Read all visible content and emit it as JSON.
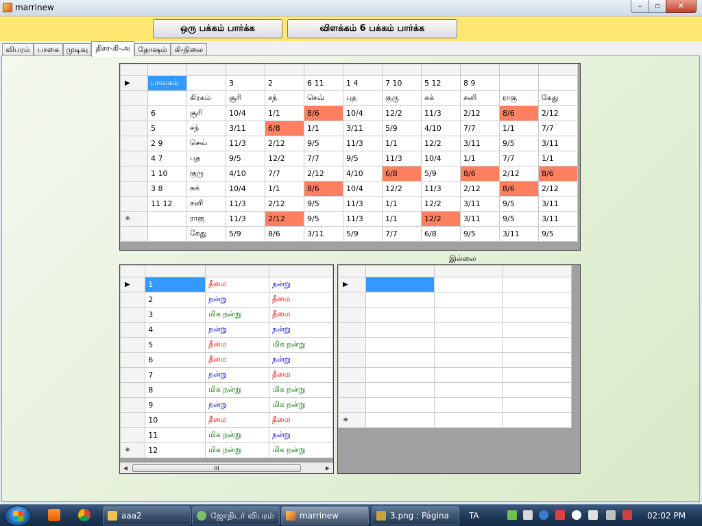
{
  "window": {
    "title": "marrinew",
    "min": "–",
    "max": "▫",
    "close": "✕"
  },
  "toolbar": {
    "btn_page": "ஒரு பக்கம் பார்க்க",
    "btn_detail": "விளக்கம் 6 பக்கம் பார்க்க"
  },
  "tabs": [
    "விபரம்",
    "பாகை",
    "முடிவு",
    "திசா-கி-அ",
    "தோஷம்",
    "கி-நிலை"
  ],
  "active_tab": 3,
  "grid1": {
    "header": [
      "",
      "",
      "",
      "",
      "",
      "",
      "",
      "",
      "",
      "",
      ""
    ],
    "row_markers": [
      "▶",
      "",
      "",
      "",
      "",
      "",
      "",
      "",
      "",
      "✳"
    ],
    "rows": [
      [
        "பாவகம்",
        "",
        "3",
        "2",
        "6 11",
        "1 4",
        "7 10",
        "5 12",
        "8 9",
        "",
        ""
      ],
      [
        "",
        "கிரகம்",
        "சூரி",
        "சந்",
        "செவ்",
        "புத",
        "குரு",
        "சுக்",
        "சனி",
        "ராகு",
        "கேது"
      ],
      [
        "6",
        "சூரி",
        "10/4",
        "1/1",
        "8/6",
        "10/4",
        "12/2",
        "11/3",
        "2/12",
        "8/6",
        "2/12"
      ],
      [
        "5",
        "சந்",
        "3/11",
        "6/8",
        "1/1",
        "3/11",
        "5/9",
        "4/10",
        "7/7",
        "1/1",
        "7/7"
      ],
      [
        "2 9",
        "செவ்",
        "11/3",
        "2/12",
        "9/5",
        "11/3",
        "1/1",
        "12/2",
        "3/11",
        "9/5",
        "3/11"
      ],
      [
        "4 7",
        "புத",
        "9/5",
        "12/2",
        "7/7",
        "9/5",
        "11/3",
        "10/4",
        "1/1",
        "7/7",
        "1/1"
      ],
      [
        "1 10",
        "குரு",
        "4/10",
        "7/7",
        "2/12",
        "4/10",
        "6/8",
        "5/9",
        "8/6",
        "2/12",
        "8/6"
      ],
      [
        "3 8",
        "சுக்",
        "10/4",
        "1/1",
        "8/6",
        "10/4",
        "12/2",
        "11/3",
        "2/12",
        "8/6",
        "2/12"
      ],
      [
        "11 12",
        "சனி",
        "11/3",
        "2/12",
        "9/5",
        "11/3",
        "1/1",
        "12/2",
        "3/11",
        "9/5",
        "3/11"
      ],
      [
        "",
        "ராகு",
        "11/3",
        "2/12",
        "9/5",
        "11/3",
        "1/1",
        "12/2",
        "3/11",
        "9/5",
        "3/11"
      ],
      [
        "",
        "கேது",
        "5/9",
        "8/6",
        "3/11",
        "5/9",
        "7/7",
        "6/8",
        "9/5",
        "3/11",
        "9/5"
      ]
    ],
    "highlight_color": "#ff8060",
    "selected_color": "#3399ff"
  },
  "grid2": {
    "row_markers": [
      "▶",
      "",
      "",
      "",
      "",
      "",
      "",
      "",
      "",
      "",
      "",
      "✳"
    ],
    "rows": [
      [
        "1",
        "தீமை",
        "நன்று"
      ],
      [
        "2",
        "நன்று",
        "தீமை"
      ],
      [
        "3",
        "மிக நன்று",
        "தீமை"
      ],
      [
        "4",
        "நன்று",
        "நன்று"
      ],
      [
        "5",
        "தீமை",
        "மிக நன்று"
      ],
      [
        "6",
        "தீமை",
        "நன்று"
      ],
      [
        "7",
        "நன்று",
        "தீமை"
      ],
      [
        "8",
        "மிக நன்று",
        "மிக நன்று"
      ],
      [
        "9",
        "நன்று",
        "மிக நன்று"
      ],
      [
        "10",
        "தீமை",
        "தீமை"
      ],
      [
        "11",
        "மிக நன்று",
        "நன்று"
      ],
      [
        "12",
        "மிக நன்று",
        "மிக நன்று"
      ]
    ],
    "scroll_left": "◀",
    "scroll_right": "▶",
    "scroll_grip": "III"
  },
  "status_label": "இல்லை",
  "grid3": {
    "row_markers": [
      "▶",
      "",
      "",
      "",
      "",
      "",
      "",
      "",
      "",
      "✳"
    ]
  },
  "taskbar": {
    "items": [
      "aaa2",
      "ஜோதிடர் விபரம்",
      "marrinew",
      "3.png : Página ..."
    ],
    "lang": "TA",
    "time": "02:02 PM"
  }
}
